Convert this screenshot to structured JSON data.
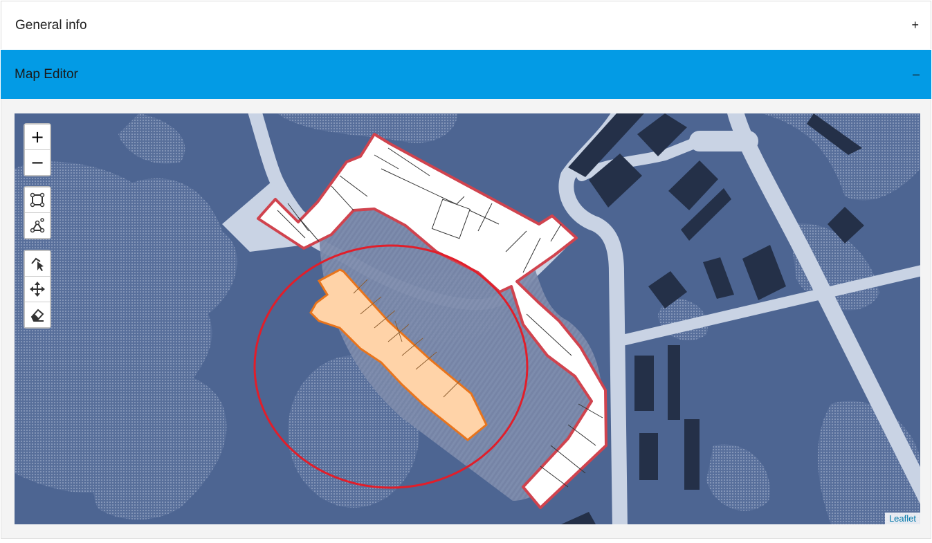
{
  "panels": {
    "general": {
      "title": "General info",
      "toggle": "+"
    },
    "editor": {
      "title": "Map Editor",
      "toggle": "–"
    }
  },
  "map": {
    "attribution": "Leaflet",
    "zoom_in_label": "+",
    "zoom_out_label": "−",
    "tools": [
      "draw-rectangle-icon",
      "draw-polygon-icon",
      "edit-vertices-icon",
      "drag-move-icon",
      "eraser-icon"
    ],
    "colors": {
      "background": "#4d6592",
      "roads": "#c9d3e4",
      "dark_buildings": "#243048",
      "outline_red": "#d0434e",
      "selected_fill": "#ffd3a8",
      "selected_stroke": "#e8741c",
      "circle": "#e11e2a"
    }
  }
}
